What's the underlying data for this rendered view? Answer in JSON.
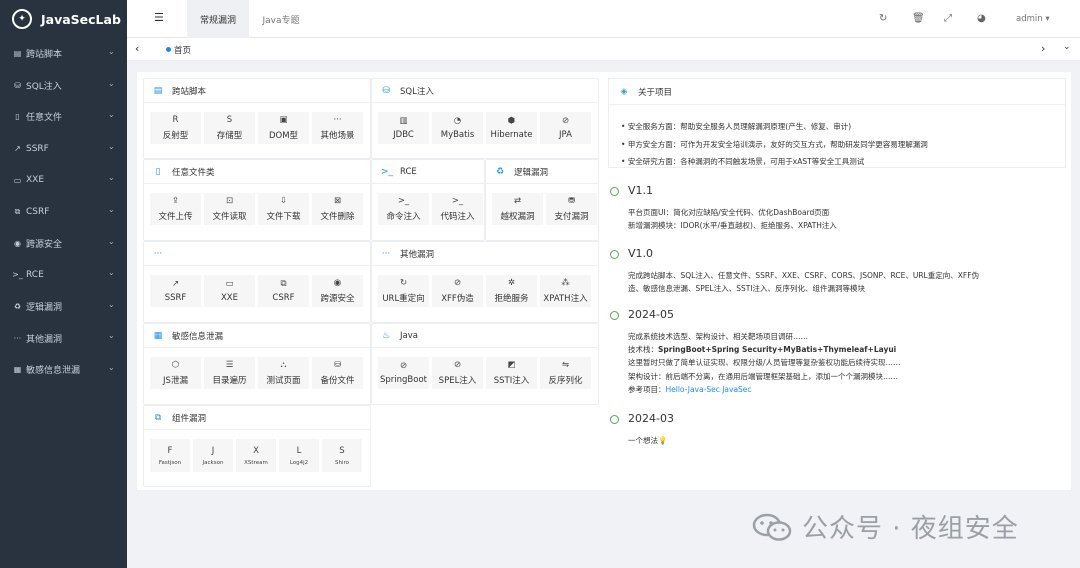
{
  "app": {
    "name": "JavaSecLab"
  },
  "sidebar": {
    "items": [
      {
        "icon": "code-icon",
        "glyph": "▤",
        "label": "跨站脚本"
      },
      {
        "icon": "database-icon",
        "glyph": "⛁",
        "label": "SQL注入"
      },
      {
        "icon": "file-icon",
        "glyph": "▯",
        "label": "任意文件"
      },
      {
        "icon": "external-link-icon",
        "glyph": "↗",
        "label": "SSRF"
      },
      {
        "icon": "document-icon",
        "glyph": "▭",
        "label": "XXE"
      },
      {
        "icon": "copy-icon",
        "glyph": "⧉",
        "label": "CSRF"
      },
      {
        "icon": "compass-icon",
        "glyph": "◉",
        "label": "跨源安全"
      },
      {
        "icon": "terminal-icon",
        "glyph": ">_",
        "label": "RCE"
      },
      {
        "icon": "recycle-icon",
        "glyph": "♻",
        "label": "逻辑漏洞"
      },
      {
        "icon": "more-icon",
        "glyph": "···",
        "label": "其他漏洞"
      },
      {
        "icon": "eye-icon",
        "glyph": "▦",
        "label": "敏感信息泄漏"
      }
    ]
  },
  "tabs": [
    {
      "label": "常规漏洞"
    },
    {
      "label": "Java专题"
    }
  ],
  "topbar": {
    "user": "admin"
  },
  "breadcrumb": {
    "home": "首页"
  },
  "cards": {
    "xss": {
      "title": "跨站脚本",
      "glyph": "▤",
      "items": [
        {
          "glyph": "R",
          "label": "反射型"
        },
        {
          "glyph": "S",
          "label": "存储型"
        },
        {
          "glyph": "▣",
          "label": "DOM型"
        },
        {
          "glyph": "···",
          "label": "其他场景"
        }
      ]
    },
    "sqli": {
      "title": "SQL注入",
      "glyph": "⛁",
      "items": [
        {
          "glyph": "▥",
          "label": "JDBC"
        },
        {
          "glyph": "◔",
          "label": "MyBatis"
        },
        {
          "glyph": "⬢",
          "label": "Hibernate"
        },
        {
          "glyph": "⊘",
          "label": "JPA"
        }
      ]
    },
    "file": {
      "title": "任意文件类",
      "glyph": "▯",
      "items": [
        {
          "glyph": "⇪",
          "label": "文件上传"
        },
        {
          "glyph": "⊡",
          "label": "文件读取"
        },
        {
          "glyph": "⇩",
          "label": "文件下载"
        },
        {
          "glyph": "⊠",
          "label": "文件删除"
        }
      ]
    },
    "rce": {
      "title": "RCE",
      "glyph": ">_",
      "items": [
        {
          "glyph": ">_",
          "label": "命令注入"
        },
        {
          "glyph": ">_",
          "label": "代码注入"
        }
      ]
    },
    "logic": {
      "title": "逻辑漏洞",
      "glyph": "♻",
      "items": [
        {
          "glyph": "⇄",
          "label": "越权漏洞"
        },
        {
          "glyph": "⛃",
          "label": "支付漏洞"
        }
      ]
    },
    "misc1": {
      "title": "",
      "glyph": "···",
      "items": [
        {
          "glyph": "↗",
          "label": "SSRF"
        },
        {
          "glyph": "▭",
          "label": "XXE"
        },
        {
          "glyph": "⧉",
          "label": "CSRF"
        },
        {
          "glyph": "◉",
          "label": "跨源安全"
        }
      ]
    },
    "other": {
      "title": "其他漏洞",
      "glyph": "···",
      "items": [
        {
          "glyph": "↻",
          "label": "URL重定向"
        },
        {
          "glyph": "⊘",
          "label": "XFF伪造"
        },
        {
          "glyph": "✲",
          "label": "拒绝服务"
        },
        {
          "glyph": "⁂",
          "label": "XPATH注入"
        }
      ]
    },
    "sensitive": {
      "title": "敏感信息泄漏",
      "glyph": "▦",
      "items": [
        {
          "glyph": "⬡",
          "label": "JS泄漏"
        },
        {
          "glyph": "☰",
          "label": "目录遍历"
        },
        {
          "glyph": "⛬",
          "label": "测试页面"
        },
        {
          "glyph": "⛁",
          "label": "备份文件"
        }
      ]
    },
    "java": {
      "title": "Java",
      "glyph": "♨",
      "items": [
        {
          "glyph": "⊘",
          "label": "SpringBoot"
        },
        {
          "glyph": "⊘",
          "label": "SPEL注入"
        },
        {
          "glyph": "◩",
          "label": "SSTI注入"
        },
        {
          "glyph": "⇋",
          "label": "反序列化"
        }
      ]
    },
    "component": {
      "title": "组件漏洞",
      "glyph": "⧉",
      "items": [
        {
          "glyph": "F",
          "label": "Fastjson"
        },
        {
          "glyph": "J",
          "label": "Jackson"
        },
        {
          "glyph": "X",
          "label": "XStream"
        },
        {
          "glyph": "L",
          "label": "Log4j2"
        },
        {
          "glyph": "S",
          "label": "Shiro"
        }
      ]
    }
  },
  "about": {
    "title": "关于项目",
    "lines": [
      "安全服务方面：帮助安全服务人员理解漏洞原理(产生、修复、审计)",
      "甲方安全方面：可作为开发安全培训演示，友好的交互方式，帮助研发同学更容易理解漏洞",
      "安全研究方面：各种漏洞的不同触发场景，可用于xAST等安全工具测试"
    ]
  },
  "timeline": [
    {
      "title": "V1.1",
      "lines": [
        "平台页面UI：简化对应缺陷/安全代码、优化DashBoard页面",
        "新增漏洞模块：IDOR(水平/垂直越权)、拒绝服务、XPATH注入"
      ]
    },
    {
      "title": "V1.0",
      "lines": [
        "完成跨站脚本、SQL注入、任意文件、SSRF、XXE、CSRF、CORS、JSONP、RCE、URL重定向、XFF伪",
        "造、敏感信息泄漏、SPEL注入、SSTI注入、反序列化、组件漏洞等模块"
      ]
    },
    {
      "title": "2024-05",
      "lines": [
        "完成系统技术选型、架构设计、相关靶场项目调研……"
      ],
      "stack_label": "技术栈：",
      "stack": "SpringBoot+Spring Security+MyBatis+Thymeleaf+Layui",
      "more": [
        "这里暂时只做了简单认证实现、权限分级/人员管理等复杂鉴权功能后续待实现……",
        "架构设计：前后端不分离，在通用后端管理框架基础上，添加一个个漏洞模块……"
      ],
      "ref_label": "参考项目：",
      "ref": "Hello-Java-Sec JavaSec"
    },
    {
      "title": "2024-03",
      "lines": [
        "一个想法💡"
      ]
    }
  ],
  "watermark": "公众号 · 夜组安全"
}
